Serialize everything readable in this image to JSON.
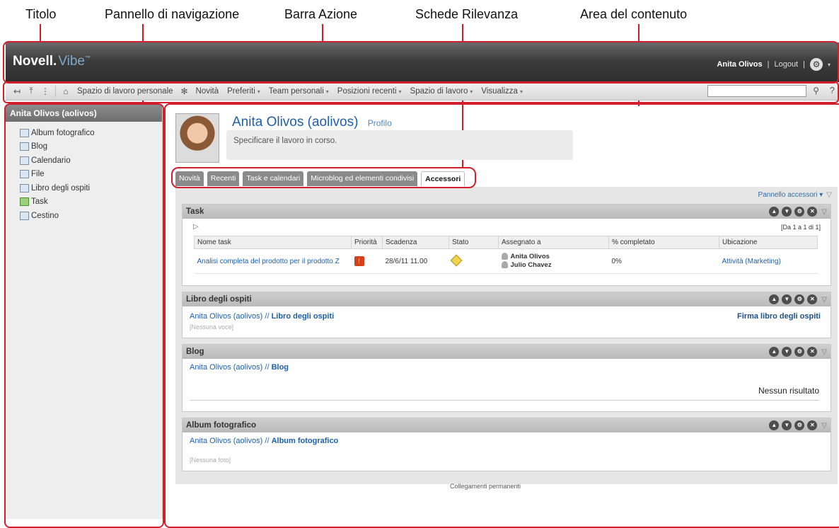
{
  "callouts": {
    "titolo": "Titolo",
    "navigazione": "Pannello di navigazione",
    "azione": "Barra Azione",
    "rilevanza": "Schede Rilevanza",
    "contenuto": "Area del contenuto"
  },
  "header": {
    "brand": "Novell.",
    "product": "Vibe",
    "tm": "™",
    "user": "Anita Olivos",
    "sep": "|",
    "logout": "Logout",
    "gear_icon": "gear-icon"
  },
  "actionbar": {
    "items": [
      {
        "label": "Spazio di lavoro personale"
      },
      {
        "label": "Novità"
      },
      {
        "label": "Preferiti",
        "arrow": "▾"
      },
      {
        "label": "Team personali",
        "arrow": "▾"
      },
      {
        "label": "Posizioni recenti",
        "arrow": "▾"
      },
      {
        "label": "Spazio di lavoro",
        "arrow": "▾"
      },
      {
        "label": "Visualizza",
        "arrow": "▾"
      }
    ],
    "search_value": ""
  },
  "nav": {
    "title": "Anita Olivos (aolivos)",
    "items": [
      {
        "label": "Album fotografico",
        "icon": "photo-album-icon"
      },
      {
        "label": "Blog",
        "icon": "blog-icon"
      },
      {
        "label": "Calendario",
        "icon": "calendar-icon"
      },
      {
        "label": "File",
        "icon": "file-icon"
      },
      {
        "label": "Libro degli ospiti",
        "icon": "guestbook-icon"
      },
      {
        "label": "Task",
        "icon": "task-icon"
      },
      {
        "label": "Cestino",
        "icon": "trash-icon"
      }
    ]
  },
  "profile": {
    "name": "Anita Olivos (aolivos)",
    "link": "Profilo",
    "status": "Specificare il lavoro in corso."
  },
  "tabs": [
    "Novità",
    "Recenti",
    "Task e calendari",
    "Microblog ed elementi condivisi",
    "Accessori"
  ],
  "panel": {
    "label": "Pannello accessori",
    "arrow": "▾"
  },
  "task": {
    "title": "Task",
    "pager": "[Da 1 a 1 di 1]",
    "columns": [
      "Nome task",
      "Priorità",
      "Scadenza",
      "Stato",
      "Assegnato a",
      "% completato",
      "Ubicazione"
    ],
    "row": {
      "name": "Analisi completa del prodotto per il prodotto Z",
      "due": "28/6/11 11.00",
      "assignee1": "Anita Olivos",
      "assignee2": "Julio Chavez",
      "completed": "0%",
      "location": "Attività (Marketing)"
    }
  },
  "guestbook": {
    "title": "Libro degli ospiti",
    "crumb_owner": "Anita Olivos (aolivos)",
    "crumb_sep": " // ",
    "crumb_target": "Libro degli ospiti",
    "sign": "Firma libro degli ospiti",
    "empty": "[Nessuna voce]"
  },
  "blog": {
    "title": "Blog",
    "crumb_owner": "Anita Olivos (aolivos)",
    "crumb_sep": " // ",
    "crumb_target": "Blog",
    "no_results": "Nessun risultato"
  },
  "album": {
    "title": "Album fotografico",
    "crumb_owner": "Anita Olivos (aolivos)",
    "crumb_sep": " // ",
    "crumb_target": "Album fotografico",
    "empty": "[Nessuna foto]"
  },
  "permalinks": "Collegamenti permanenti",
  "colors": {
    "accent": "#d11f2e",
    "link": "#2e6ea6",
    "header": "#3c3c3c"
  }
}
